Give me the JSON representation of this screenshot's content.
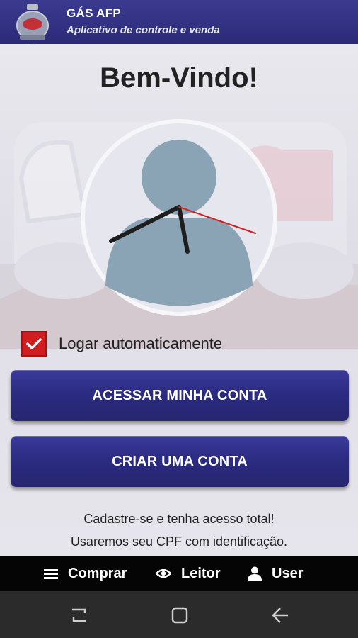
{
  "header": {
    "title": "GÁS AFP",
    "subtitle": "Aplicativo de controle e venda"
  },
  "main": {
    "welcome": "Bem-Vindo!",
    "auto_login_label": "Logar automaticamente",
    "auto_login_checked": true,
    "login_button": "ACESSAR MINHA CONTA",
    "create_button": "CRIAR UMA CONTA",
    "info_line_1": "Cadastre-se e tenha acesso total!",
    "info_line_2": "Usaremos seu CPF com identificação."
  },
  "bottom_nav": {
    "items": [
      {
        "label": "Comprar",
        "icon": "menu-icon"
      },
      {
        "label": "Leitor",
        "icon": "eye-icon"
      },
      {
        "label": "User",
        "icon": "user-icon"
      }
    ]
  },
  "system_nav": {
    "icons": [
      "recent-apps-icon",
      "home-icon",
      "back-icon"
    ]
  },
  "colors": {
    "header": "#2f2e80",
    "button": "#2e2d84",
    "checkbox": "#d11d1d",
    "bottom_nav": "#050505",
    "system_bar": "#2b2b2b"
  }
}
